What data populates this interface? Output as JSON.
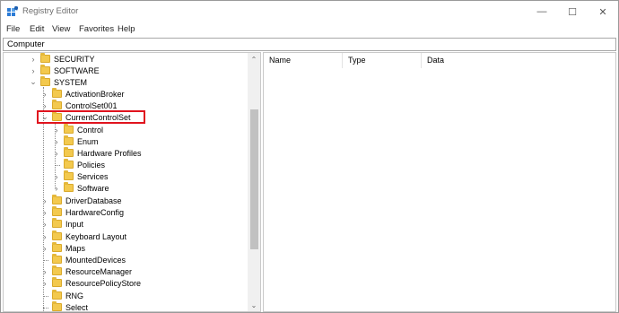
{
  "window": {
    "title": "Registry Editor",
    "controls": {
      "minimize": "—",
      "maximize": "☐",
      "close": "✕"
    }
  },
  "menu": [
    {
      "label": "File"
    },
    {
      "label": "Edit"
    },
    {
      "label": "View"
    },
    {
      "label": "Favorites"
    },
    {
      "label": "Help"
    }
  ],
  "address": "Computer",
  "tree": [
    {
      "label": "SECURITY",
      "expander": "›"
    },
    {
      "label": "SOFTWARE",
      "expander": "›"
    },
    {
      "label": "SYSTEM",
      "expander": "⌄"
    },
    {
      "label": "ActivationBroker",
      "expander": "›"
    },
    {
      "label": "ControlSet001",
      "expander": "›"
    },
    {
      "label": "CurrentControlSet",
      "expander": "⌄"
    },
    {
      "label": "Control",
      "expander": "›"
    },
    {
      "label": "Enum",
      "expander": "›"
    },
    {
      "label": "Hardware Profiles",
      "expander": "›"
    },
    {
      "label": "Policies",
      "expander": ""
    },
    {
      "label": "Services",
      "expander": "›"
    },
    {
      "label": "Software",
      "expander": "›"
    },
    {
      "label": "DriverDatabase",
      "expander": "›"
    },
    {
      "label": "HardwareConfig",
      "expander": "›"
    },
    {
      "label": "Input",
      "expander": "›"
    },
    {
      "label": "Keyboard Layout",
      "expander": "›"
    },
    {
      "label": "Maps",
      "expander": "›"
    },
    {
      "label": "MountedDevices",
      "expander": ""
    },
    {
      "label": "ResourceManager",
      "expander": "›"
    },
    {
      "label": "ResourcePolicyStore",
      "expander": "›"
    },
    {
      "label": "RNG",
      "expander": ""
    },
    {
      "label": "Select",
      "expander": ""
    }
  ],
  "scrollbar": {
    "up": "⌃",
    "down": "⌄"
  },
  "columns": [
    {
      "label": "Name"
    },
    {
      "label": "Type"
    },
    {
      "label": "Data"
    }
  ],
  "colors": {
    "highlight": "#e0141e",
    "folder": "#f3c94e"
  }
}
